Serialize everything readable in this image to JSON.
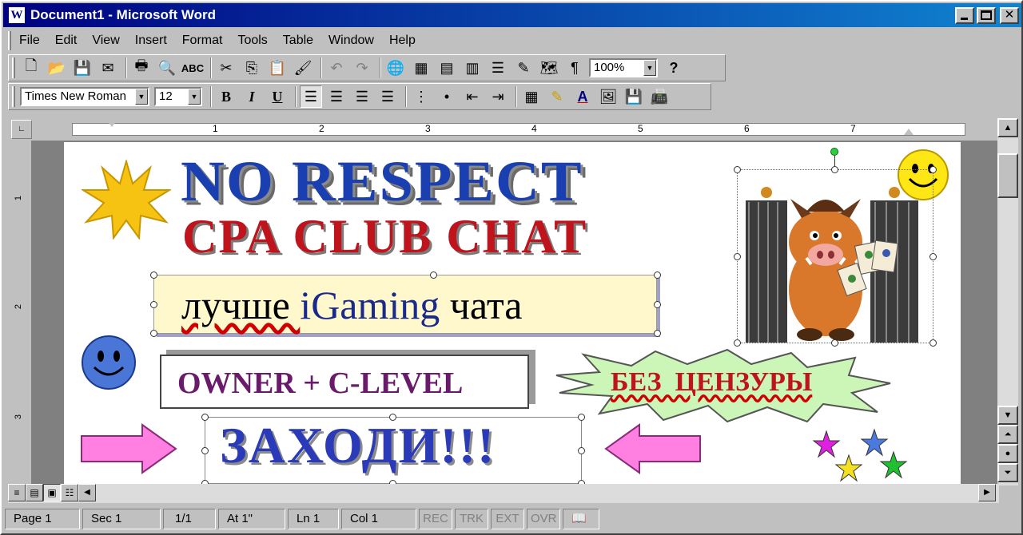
{
  "window": {
    "title": "Document1 - Microsoft Word"
  },
  "menu": [
    "File",
    "Edit",
    "View",
    "Insert",
    "Format",
    "Tools",
    "Table",
    "Window",
    "Help"
  ],
  "toolbar": {
    "zoom": "100%",
    "font": "Times New Roman",
    "size": "12",
    "bold": "B",
    "italic": "I",
    "underline": "U"
  },
  "ruler": {
    "numbers": [
      "1",
      "2",
      "3",
      "4",
      "5",
      "6",
      "7"
    ]
  },
  "vruler": {
    "numbers": [
      "1",
      "2",
      "3"
    ]
  },
  "doc": {
    "headline": "NO RESPECT",
    "subhead": "CPA CLUB CHAT",
    "box1": {
      "prefix": "лучше ",
      "highlight": "iGaming",
      "suffix": " чата"
    },
    "box2": "OWNER + C-LEVEL",
    "burst": "БЕЗ  ЦЕНЗУРЫ",
    "cta": "ЗАХОДИ!!!"
  },
  "status": {
    "page": "Page  1",
    "sec": "Sec  1",
    "pages": "1/1",
    "at": "At  1\"",
    "ln": "Ln  1",
    "col": "Col  1",
    "rec": "REC",
    "trk": "TRK",
    "ext": "EXT",
    "ovr": "OVR"
  },
  "colors": {
    "title_bar": "#000080",
    "headline": "#1a3fb0",
    "subhead": "#c0141c",
    "purple": "#6a1a6a",
    "burst_text": "#c0141c"
  }
}
